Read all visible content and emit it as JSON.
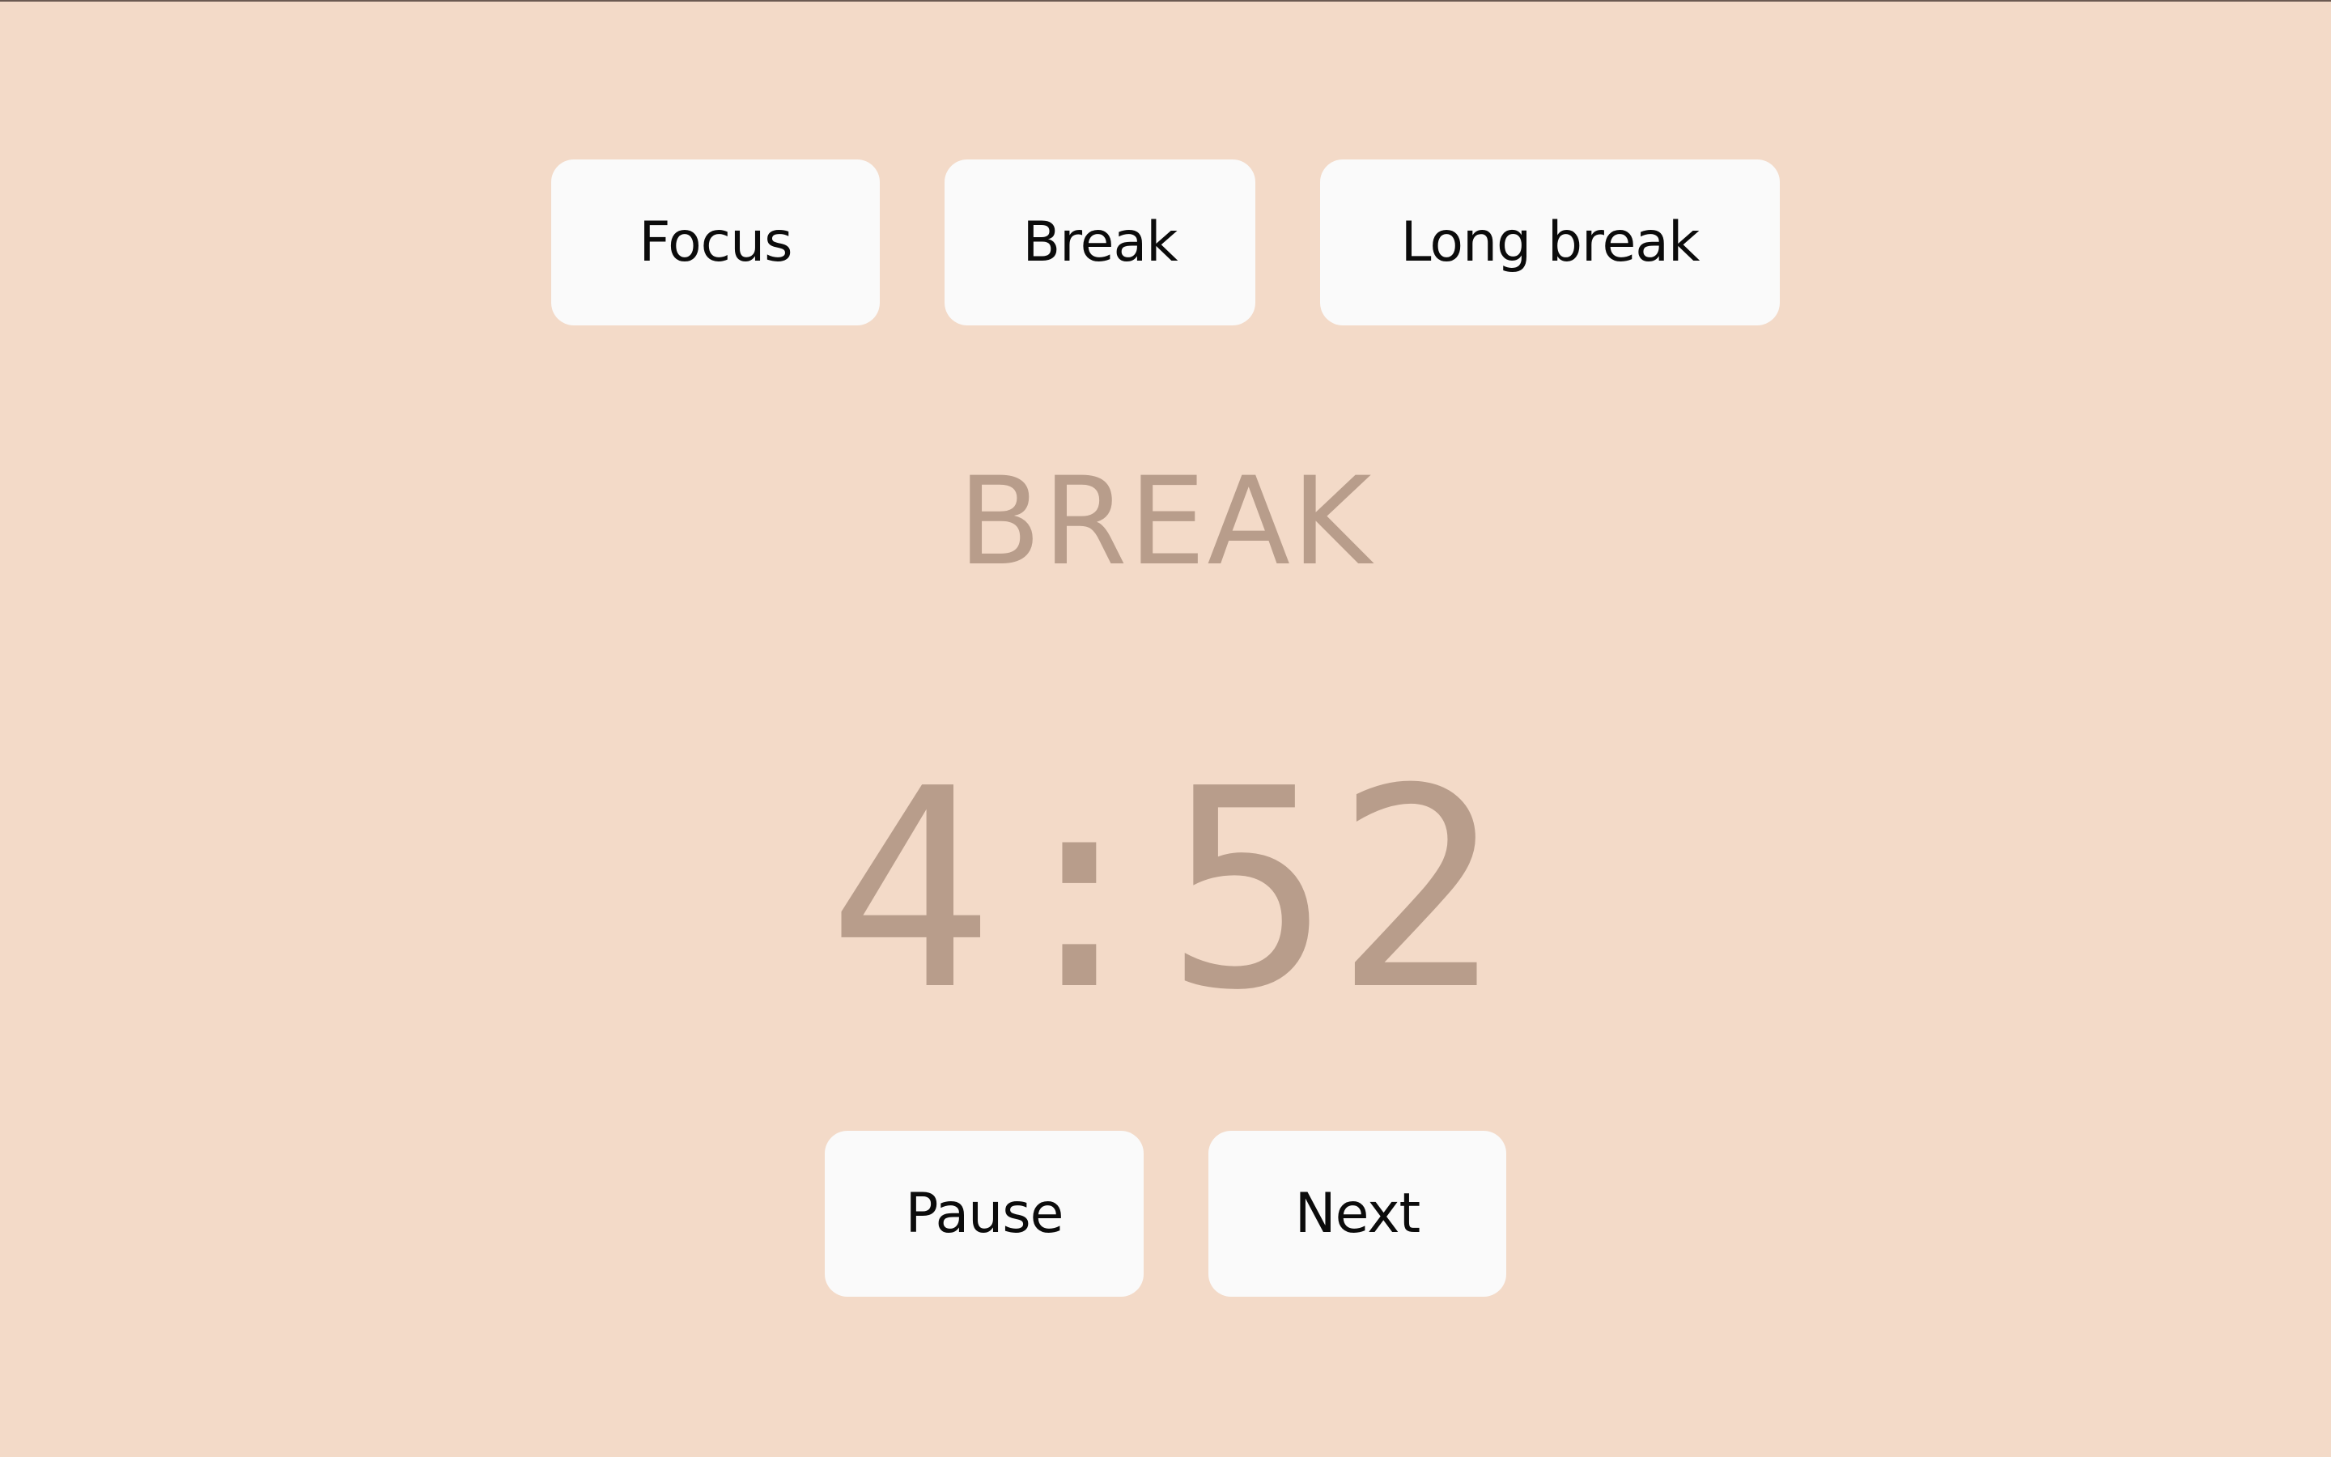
{
  "colors": {
    "background": "#f3dac8",
    "button_background": "#fafafa",
    "button_text": "#0b0b0b",
    "display_text": "#b89d8b"
  },
  "mode_tabs": [
    {
      "label": "Focus"
    },
    {
      "label": "Break"
    },
    {
      "label": "Long break"
    }
  ],
  "current_mode": "BREAK",
  "timer": "4:52",
  "controls": {
    "pause_label": "Pause",
    "next_label": "Next"
  }
}
